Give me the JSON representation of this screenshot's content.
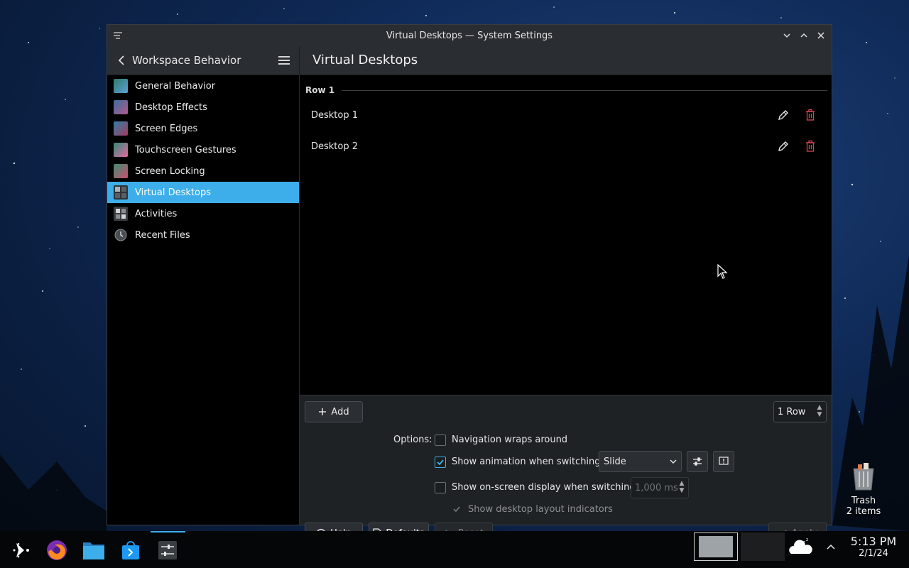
{
  "window": {
    "title": "Virtual Desktops — System Settings"
  },
  "header": {
    "breadcrumb": "Workspace Behavior",
    "page_title": "Virtual Desktops"
  },
  "sidebar": {
    "items": [
      {
        "label": "General Behavior",
        "icon": "general-behavior-icon",
        "color": "#2e7d6b"
      },
      {
        "label": "Desktop Effects",
        "icon": "desktop-effects-icon",
        "color": "#3b6f9e"
      },
      {
        "label": "Screen Edges",
        "icon": "screen-edges-icon",
        "color": "#a33b5e"
      },
      {
        "label": "Touchscreen Gestures",
        "icon": "touchscreen-gestures-icon",
        "color": "#2f8a7a"
      },
      {
        "label": "Screen Locking",
        "icon": "screen-locking-icon",
        "color": "#3f8b73"
      },
      {
        "label": "Virtual Desktops",
        "icon": "virtual-desktops-icon",
        "color": "#5d6166",
        "active": true
      },
      {
        "label": "Activities",
        "icon": "activities-icon",
        "color": "#6a6e73"
      },
      {
        "label": "Recent Files",
        "icon": "recent-files-icon",
        "color": "#4a4e53"
      }
    ]
  },
  "content": {
    "row_label": "Row 1",
    "desktops": [
      "Desktop 1",
      "Desktop 2"
    ]
  },
  "controls": {
    "add_label": "Add",
    "rows_value": "1 Row",
    "options_label": "Options:",
    "nav_wraps": {
      "label": "Navigation wraps around",
      "checked": false
    },
    "show_animation": {
      "label": "Show animation when switching:",
      "checked": true
    },
    "animation_value": "Slide",
    "show_osd": {
      "label": "Show on-screen display when switching:",
      "checked": false
    },
    "osd_duration": "1,000 ms",
    "layout_indicators": {
      "label": "Show desktop layout indicators",
      "checked": true,
      "enabled": false
    }
  },
  "footer": {
    "help_label": "Help",
    "defaults_label": "Defaults",
    "reset_label": "Reset",
    "apply_label": "Apply"
  },
  "desktop": {
    "trash_label": "Trash",
    "trash_count": "2 items"
  },
  "taskbar": {
    "time": "5:13 PM",
    "date": "2/1/24"
  },
  "colors": {
    "accent": "#3daee9",
    "delete": "#da4453"
  }
}
